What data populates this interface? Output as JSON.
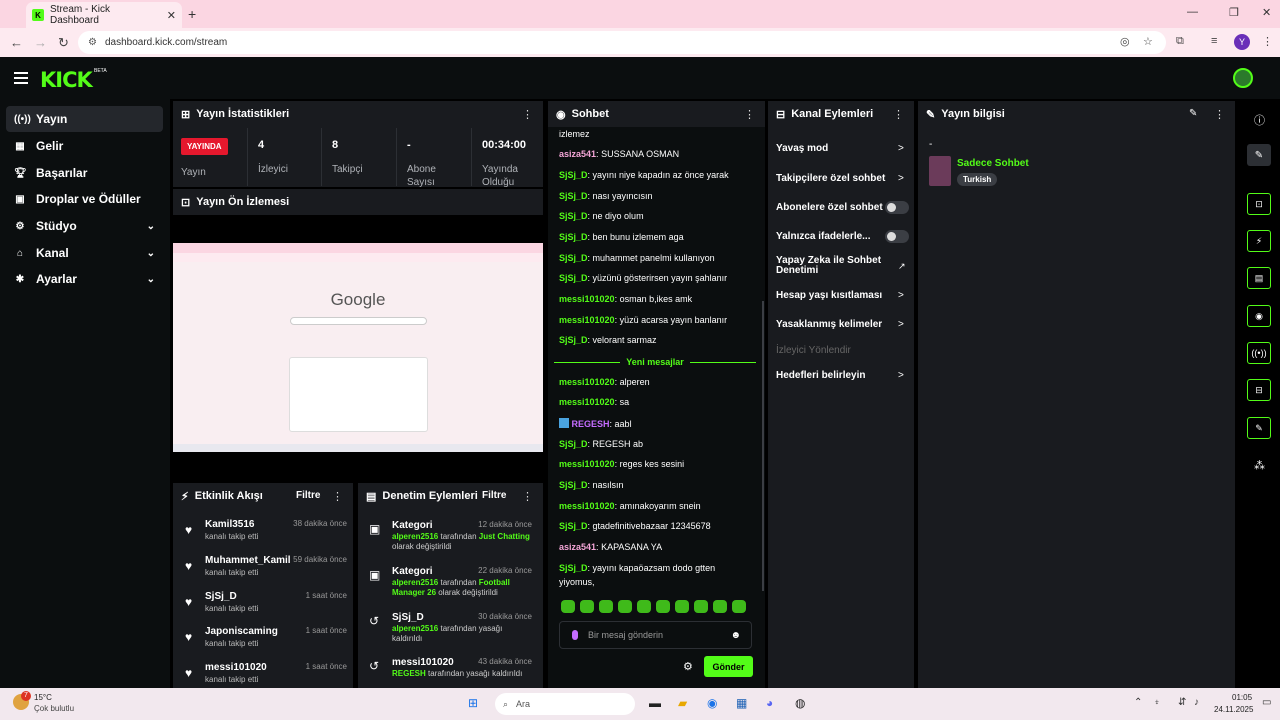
{
  "browser": {
    "tab_title": "Stream - Kick Dashboard",
    "url": "dashboard.kick.com/stream",
    "profile_initial": "Y"
  },
  "header": {
    "logo": "KICK",
    "logo_badge": "BETA"
  },
  "sidebar": {
    "items": [
      {
        "label": "Yayın",
        "icon": "broadcast-icon",
        "active": true
      },
      {
        "label": "Gelir",
        "icon": "income-icon"
      },
      {
        "label": "Başarılar",
        "icon": "trophy-icon"
      },
      {
        "label": "Droplar ve Ödüller",
        "icon": "gift-icon"
      },
      {
        "label": "Stüdyo",
        "icon": "studio-icon",
        "chevron": true
      },
      {
        "label": "Kanal",
        "icon": "channel-icon",
        "chevron": true
      },
      {
        "label": "Ayarlar",
        "icon": "gear-icon",
        "chevron": true
      }
    ]
  },
  "stats": {
    "title": "Yayın İstatistikleri",
    "live_badge": "YAYINDA",
    "live_label": "Yayın",
    "viewers": {
      "value": "4",
      "label": "İzleyici"
    },
    "followers": {
      "value": "8",
      "label": "Takipçi"
    },
    "subs": {
      "value": "-",
      "label": "Abone Sayısı"
    },
    "uptime": {
      "value": "00:34:00",
      "label": "Yayında Olduğu"
    }
  },
  "preview": {
    "title": "Yayın Ön İzlemesi",
    "google_logo": "Google"
  },
  "activity": {
    "title": "Etkinlik Akışı",
    "filter": "Filtre",
    "items": [
      {
        "name": "Kamil3516",
        "desc": "kanalı takip etti",
        "time": "38 dakika önce"
      },
      {
        "name": "Muhammet_Kamil",
        "desc": "kanalı takip etti",
        "time": "59 dakika önce"
      },
      {
        "name": "SjSj_D",
        "desc": "kanalı takip etti",
        "time": "1 saat önce"
      },
      {
        "name": "Japoniscaming",
        "desc": "kanalı takip etti",
        "time": "1 saat önce"
      },
      {
        "name": "messi101020",
        "desc": "kanalı takip etti",
        "time": "1 saat önce"
      }
    ]
  },
  "moderation": {
    "title": "Denetim Eylemleri",
    "filter": "Filtre",
    "items": [
      {
        "name": "Kategori",
        "time": "12 dakika önce",
        "user": "alperen2516",
        "mid": " tarafından ",
        "hl": "Just Chatting",
        "tail": " olarak değiştirildi"
      },
      {
        "name": "Kategori",
        "time": "22 dakika önce",
        "user": "alperen2516",
        "mid": " tarafından ",
        "hl": "Football Manager 26",
        "tail": " olarak değiştirildi"
      },
      {
        "name": "SjSj_D",
        "time": "30 dakika önce",
        "user": "alperen2516",
        "mid": " tarafından yasağı kaldırıldı",
        "hl": "",
        "tail": ""
      },
      {
        "name": "messi101020",
        "time": "43 dakika önce",
        "user": "REGESH",
        "mid": " tarafından yasağı kaldırıldı",
        "hl": "",
        "tail": ""
      }
    ]
  },
  "chat": {
    "title": "Sohbet",
    "messages": [
      {
        "user": "",
        "text": "izlemez"
      },
      {
        "user": "asiza541",
        "text": "SUSSANA OSMAN",
        "color": "pink"
      },
      {
        "user": "SjSj_D",
        "text": "yayını niye kapadın az önce yarak"
      },
      {
        "user": "SjSj_D",
        "text": "nası yayıncısın"
      },
      {
        "user": "SjSj_D",
        "text": "ne diyo olum"
      },
      {
        "user": "SjSj_D",
        "text": "ben bunu izlemem aga"
      },
      {
        "user": "SjSj_D",
        "text": "muhammet panelmi kullanıyon"
      },
      {
        "user": "SjSj_D",
        "text": "yüzünü gösterirsen yayın şahlanır"
      },
      {
        "user": "messi101020",
        "text": "osman b,ikes amk"
      },
      {
        "user": "messi101020",
        "text": "yüzü acarsa yayın banlanır"
      },
      {
        "user": "SjSj_D",
        "text": "velorant sarmaz"
      },
      {
        "user": "messi101020",
        "text": "alperen"
      },
      {
        "user": "messi101020",
        "text": "sa"
      },
      {
        "user": "REGESH",
        "text": "aabl",
        "color": "purple"
      },
      {
        "user": "SjSj_D",
        "text": "REGESH ab"
      },
      {
        "user": "messi101020",
        "text": "reges kes sesini"
      },
      {
        "user": "SjSj_D",
        "text": "nasılsın"
      },
      {
        "user": "messi101020",
        "text": "amınakoyarım snein"
      },
      {
        "user": "SjSj_D",
        "text": "gtadefinitivebazaar 12345678"
      },
      {
        "user": "asiza541",
        "text": "KAPASANA YA",
        "color": "pink"
      },
      {
        "user": "SjSj_D",
        "text": "yayını kapaöazsam dodo gtten"
      },
      {
        "user": "",
        "text": "yiyomus,"
      }
    ],
    "new_messages": "Yeni mesajlar",
    "input_placeholder": "Bir mesaj gönderin",
    "send": "Gönder"
  },
  "channel_actions": {
    "title": "Kanal Eylemleri",
    "items": [
      {
        "label": "Yavaş mod",
        "type": "arrow"
      },
      {
        "label": "Takipçilere özel sohbet",
        "type": "arrow"
      },
      {
        "label": "Abonelere özel sohbet",
        "type": "toggle"
      },
      {
        "label": "Yalnızca ifadelerle...",
        "type": "toggle"
      },
      {
        "label": "Yapay Zeka ile Sohbet Denetimi",
        "type": "external"
      },
      {
        "label": "Hesap yaşı kısıtlaması",
        "type": "arrow"
      },
      {
        "label": "Yasaklanmış kelimeler",
        "type": "arrow"
      },
      {
        "label": "İzleyici Yönlendir",
        "type": "disabled"
      },
      {
        "label": "Hedefleri belirleyin",
        "type": "arrow"
      }
    ]
  },
  "stream_info": {
    "title": "Yayın bilgisi",
    "stream_title": "-",
    "category": "Sadece Sohbet",
    "tag": "Turkish"
  },
  "taskbar": {
    "temp": "15°C",
    "weather": "Çok bulutlu",
    "search": "Ara",
    "time": "01:05",
    "date": "24.11.2025",
    "badge": "7"
  }
}
